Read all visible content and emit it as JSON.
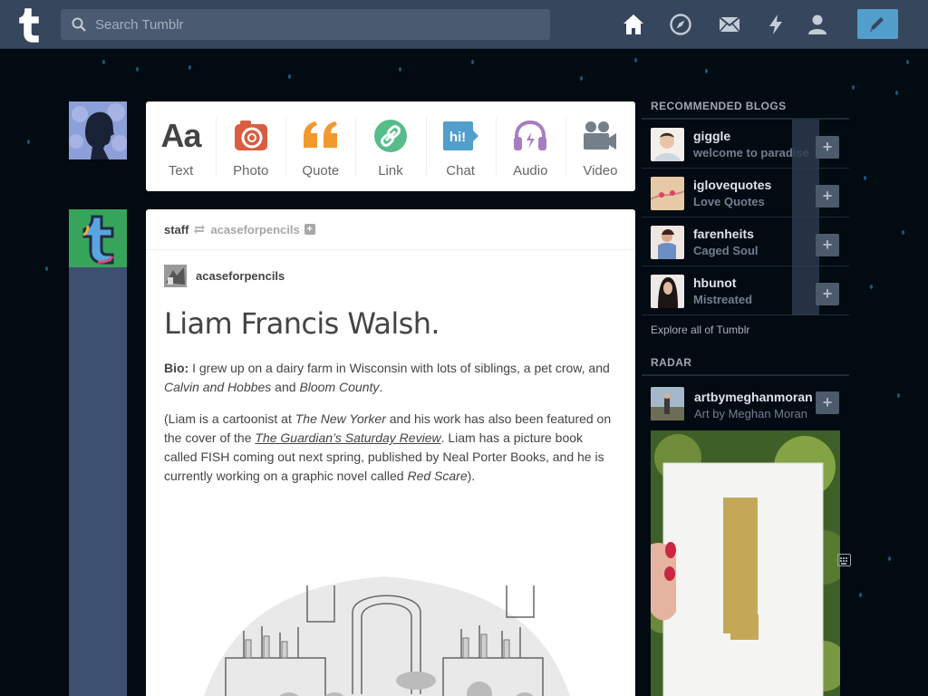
{
  "topbar": {
    "search_placeholder": "Search Tumblr",
    "nav_icons": [
      "home-icon",
      "compass-icon",
      "mail-icon",
      "lightning-icon",
      "person-icon"
    ],
    "compose_icon": "pencil-icon",
    "bg_color": "#36465d",
    "accent_color": "#529ecc"
  },
  "post_types": [
    {
      "label": "Text",
      "icon": "text-icon",
      "color": "#444444"
    },
    {
      "label": "Photo",
      "icon": "camera-icon",
      "color": "#d95e40"
    },
    {
      "label": "Quote",
      "icon": "quote-icon",
      "color": "#f2992e"
    },
    {
      "label": "Link",
      "icon": "link-icon",
      "color": "#56bc8a"
    },
    {
      "label": "Chat",
      "icon": "chat-icon",
      "color": "#529ecc"
    },
    {
      "label": "Audio",
      "icon": "headphones-icon",
      "color": "#a77dc2"
    },
    {
      "label": "Video",
      "icon": "video-camera-icon",
      "color": "#748089"
    }
  ],
  "post": {
    "reblogger": "staff",
    "reblogged_from": "acaseforpencils",
    "source_blog": "acaseforpencils",
    "title": "Liam Francis Walsh.",
    "bio_label": "Bio:",
    "bio_text": " I grew up on a dairy farm in Wisconsin with lots of siblings, a pet crow, and ",
    "bio_em1": "Calvin and Hobbes",
    "bio_and": " and ",
    "bio_em2": "Bloom County",
    "bio_end": ".",
    "p2_a": "(Liam is a cartoonist at ",
    "p2_em1": "The New Yorker",
    "p2_b": " and his work has also been featured on the cover of the ",
    "p2_link": "The Guardian’s Saturday Review",
    "p2_c": ". Liam has a picture book called FISH coming out next spring, published by Neal Porter Books, and he is currently working on a graphic novel called ",
    "p2_em2": "Red Scare",
    "p2_d": ")."
  },
  "sidebar": {
    "recommended_title": "RECOMMENDED BLOGS",
    "blogs": [
      {
        "name": "giggle",
        "title": "welcome to paradise"
      },
      {
        "name": "iglovequotes",
        "title": "Love Quotes"
      },
      {
        "name": "farenheits",
        "title": "Caged Soul"
      },
      {
        "name": "hbunot",
        "title": "Mistreated"
      }
    ],
    "explore": "Explore all of Tumblr",
    "radar_title": "RADAR",
    "radar_blog": {
      "name": "artbymeghanmoran",
      "title": "Art by Meghan Moran"
    }
  }
}
